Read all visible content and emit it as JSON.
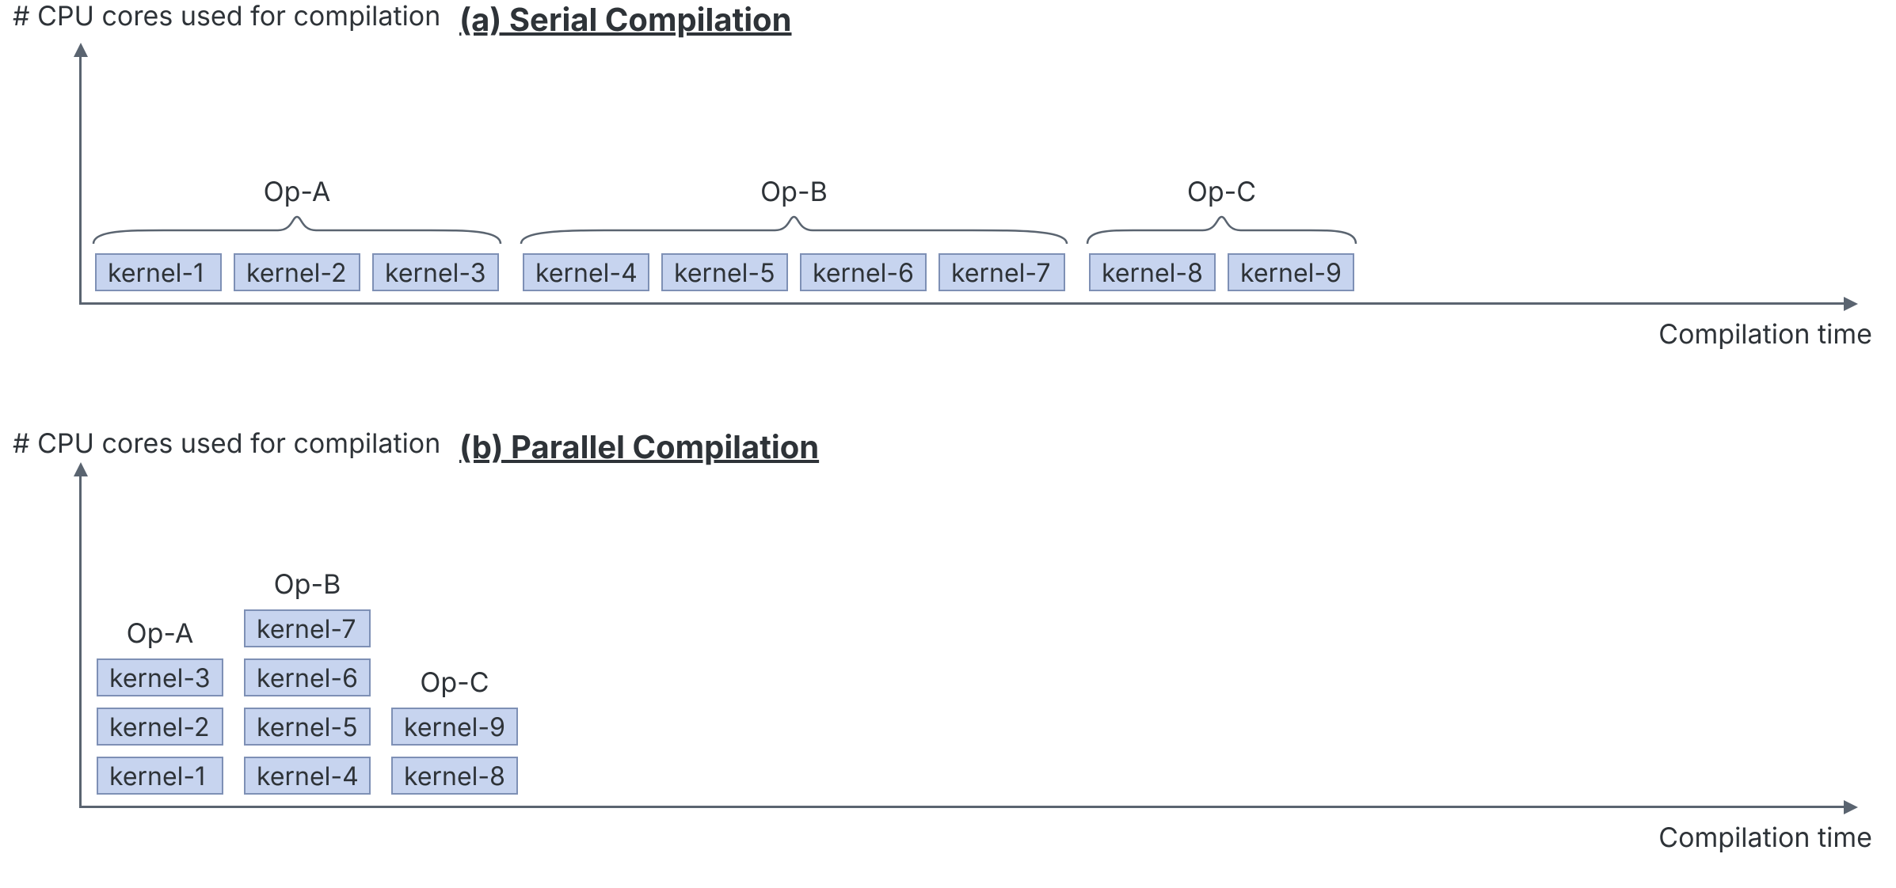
{
  "axis_color": "#5a6470",
  "box_fill": "#c7d4ef",
  "box_border": "#7e90b5",
  "labels": {
    "y_axis": "# CPU cores used for compilation",
    "x_axis": "Compilation time"
  },
  "panel_a": {
    "title": "(a) Serial Compilation",
    "ops": [
      {
        "name": "Op-A",
        "kernels": [
          "kernel-1",
          "kernel-2",
          "kernel-3"
        ]
      },
      {
        "name": "Op-B",
        "kernels": [
          "kernel-4",
          "kernel-5",
          "kernel-6",
          "kernel-7"
        ]
      },
      {
        "name": "Op-C",
        "kernels": [
          "kernel-8",
          "kernel-9"
        ]
      }
    ]
  },
  "panel_b": {
    "title": "(b) Parallel Compilation",
    "ops": [
      {
        "name": "Op-A",
        "kernels": [
          "kernel-1",
          "kernel-2",
          "kernel-3"
        ]
      },
      {
        "name": "Op-B",
        "kernels": [
          "kernel-4",
          "kernel-5",
          "kernel-6",
          "kernel-7"
        ]
      },
      {
        "name": "Op-C",
        "kernels": [
          "kernel-8",
          "kernel-9"
        ]
      }
    ]
  },
  "chart_data": [
    {
      "type": "bar",
      "title": "(a) Serial Compilation",
      "xlabel": "Compilation time",
      "ylabel": "# CPU cores used for compilation",
      "series": [
        {
          "name": "Op-A",
          "items": [
            {
              "kernel": "kernel-1",
              "start": 0,
              "end": 1,
              "core": 1
            },
            {
              "kernel": "kernel-2",
              "start": 1,
              "end": 2,
              "core": 1
            },
            {
              "kernel": "kernel-3",
              "start": 2,
              "end": 3,
              "core": 1
            }
          ]
        },
        {
          "name": "Op-B",
          "items": [
            {
              "kernel": "kernel-4",
              "start": 3,
              "end": 4,
              "core": 1
            },
            {
              "kernel": "kernel-5",
              "start": 4,
              "end": 5,
              "core": 1
            },
            {
              "kernel": "kernel-6",
              "start": 5,
              "end": 6,
              "core": 1
            },
            {
              "kernel": "kernel-7",
              "start": 6,
              "end": 7,
              "core": 1
            }
          ]
        },
        {
          "name": "Op-C",
          "items": [
            {
              "kernel": "kernel-8",
              "start": 7,
              "end": 8,
              "core": 1
            },
            {
              "kernel": "kernel-9",
              "start": 8,
              "end": 9,
              "core": 1
            }
          ]
        }
      ]
    },
    {
      "type": "bar",
      "title": "(b) Parallel Compilation",
      "xlabel": "Compilation time",
      "ylabel": "# CPU cores used for compilation",
      "series": [
        {
          "name": "Op-A",
          "items": [
            {
              "kernel": "kernel-1",
              "start": 0,
              "end": 1,
              "core": 1
            },
            {
              "kernel": "kernel-2",
              "start": 0,
              "end": 1,
              "core": 2
            },
            {
              "kernel": "kernel-3",
              "start": 0,
              "end": 1,
              "core": 3
            }
          ]
        },
        {
          "name": "Op-B",
          "items": [
            {
              "kernel": "kernel-4",
              "start": 1,
              "end": 2,
              "core": 1
            },
            {
              "kernel": "kernel-5",
              "start": 1,
              "end": 2,
              "core": 2
            },
            {
              "kernel": "kernel-6",
              "start": 1,
              "end": 2,
              "core": 3
            },
            {
              "kernel": "kernel-7",
              "start": 1,
              "end": 2,
              "core": 4
            }
          ]
        },
        {
          "name": "Op-C",
          "items": [
            {
              "kernel": "kernel-8",
              "start": 2,
              "end": 3,
              "core": 1
            },
            {
              "kernel": "kernel-9",
              "start": 2,
              "end": 3,
              "core": 2
            }
          ]
        }
      ]
    }
  ]
}
